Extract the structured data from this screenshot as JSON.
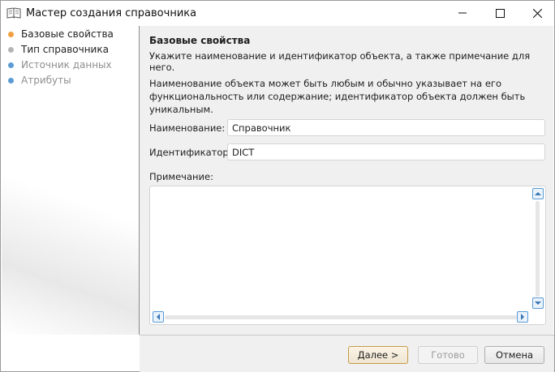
{
  "window": {
    "title": "Мастер создания справочника",
    "icon": "book-icon"
  },
  "steps": [
    {
      "label": "Базовые свойства",
      "state": "active",
      "color": "#f0a040"
    },
    {
      "label": "Тип справочника",
      "state": "normal",
      "color": "#b4b4b4"
    },
    {
      "label": "Источник данных",
      "state": "disabled",
      "color": "#5b9bd5"
    },
    {
      "label": "Атрибуты",
      "state": "disabled",
      "color": "#5b9bd5"
    }
  ],
  "page": {
    "title": "Базовые свойства",
    "subtitle": "Укажите наименование и идентификатор объекта, а также примечание для него.",
    "description": "Наименование объекта может быть любым и обычно указывает на его функциональность или содержание; идентификатор объекта должен быть уникальным."
  },
  "form": {
    "name_label": "Наименование:",
    "name_value": "Справочник",
    "id_label": "Идентификатор:",
    "id_value": "DICT",
    "notes_label": "Примечание:",
    "notes_value": ""
  },
  "buttons": {
    "next": "Далее >",
    "finish": "Готово",
    "cancel": "Отмена"
  },
  "colors": {
    "accent_orange": "#f0a040",
    "scroll_blue": "#5a9bd5"
  }
}
